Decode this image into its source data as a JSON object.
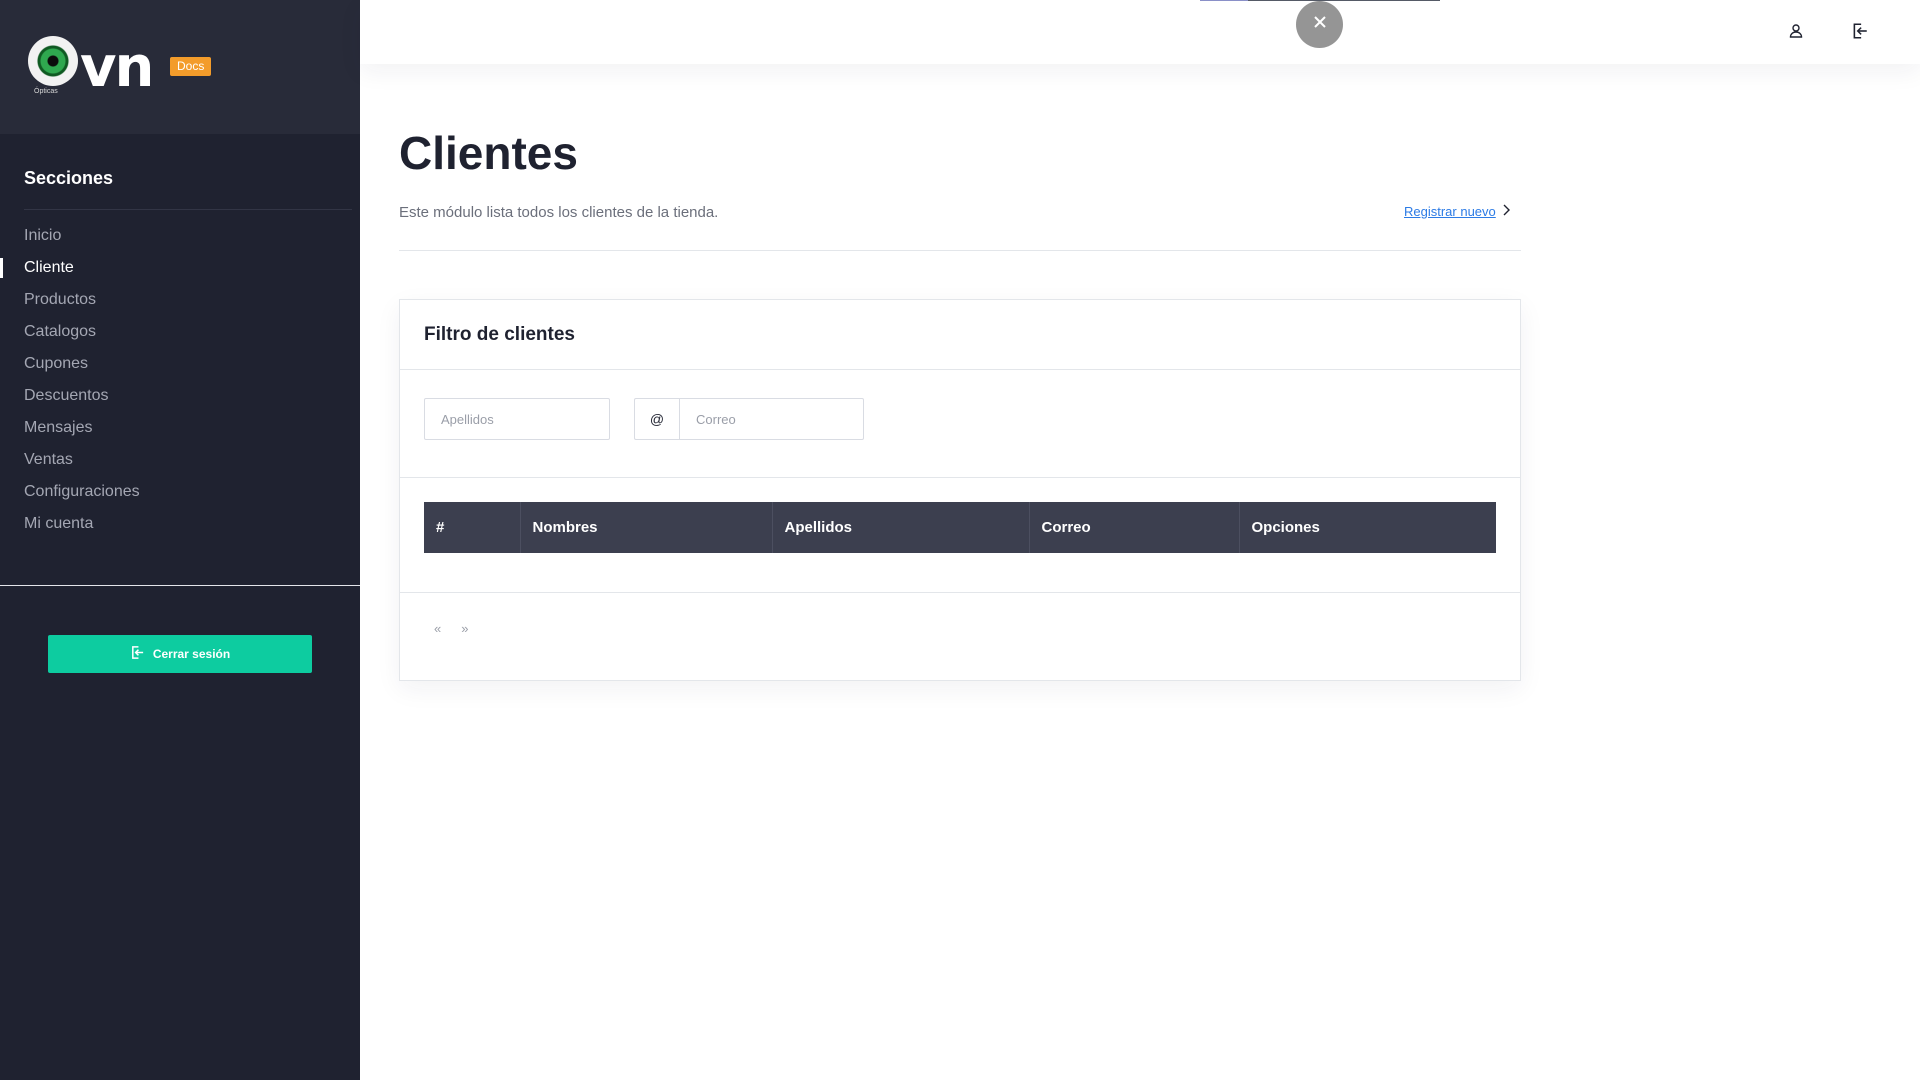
{
  "brand": {
    "logo_text": "vn",
    "logo_subtext": "Ópticas",
    "docs_badge": "Docs"
  },
  "sidebar": {
    "sections_title": "Secciones",
    "items": [
      {
        "label": "Inicio",
        "active": false
      },
      {
        "label": "Cliente",
        "active": true
      },
      {
        "label": "Productos",
        "active": false
      },
      {
        "label": "Catalogos",
        "active": false
      },
      {
        "label": "Cupones",
        "active": false
      },
      {
        "label": "Descuentos",
        "active": false
      },
      {
        "label": "Mensajes",
        "active": false
      },
      {
        "label": "Ventas",
        "active": false
      },
      {
        "label": "Configuraciones",
        "active": false
      },
      {
        "label": "Mi cuenta",
        "active": false
      }
    ],
    "logout_label": "Cerrar sesión"
  },
  "topbar": {
    "icons": [
      "user-icon",
      "logout-icon"
    ],
    "close_icon": "close-icon"
  },
  "page": {
    "title": "Clientes",
    "subtitle": "Este módulo lista todos los clientes de la tienda.",
    "register_link": "Registrar nuevo"
  },
  "filter_card": {
    "title": "Filtro de clientes",
    "surname_placeholder": "Apellidos",
    "email_addon": "@",
    "email_placeholder": "Correo",
    "table_headers": [
      "#",
      "Nombres",
      "Apellidos",
      "Correo",
      "Opciones"
    ],
    "pager_prev": "«",
    "pager_next": "»"
  },
  "colors": {
    "sidebar_bg": "#1f2230",
    "accent": "#0dcca0",
    "badge": "#f39c2b",
    "table_header": "#3c3f4f",
    "link": "#2c7be5"
  }
}
